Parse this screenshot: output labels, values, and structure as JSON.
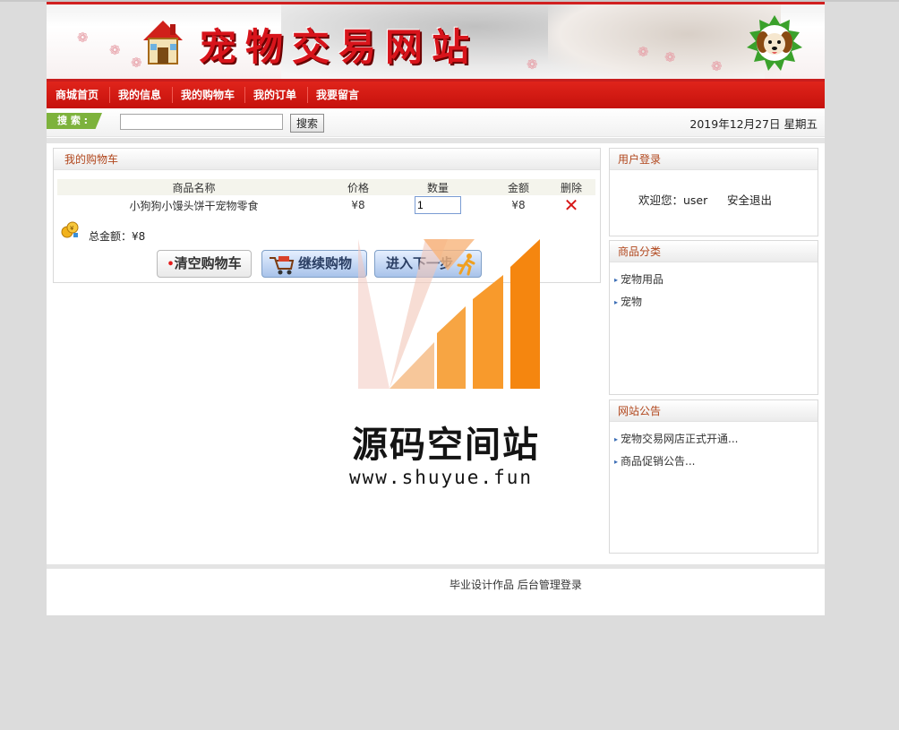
{
  "header": {
    "site_title": "宠物交易网站"
  },
  "nav": {
    "items": [
      {
        "label": "商城首页"
      },
      {
        "label": "我的信息"
      },
      {
        "label": "我的购物车"
      },
      {
        "label": "我的订单"
      },
      {
        "label": "我要留言"
      }
    ]
  },
  "search": {
    "tag_label": "搜 索 :",
    "input_value": "",
    "button_label": "搜索",
    "date_text": "2019年12月27日 星期五"
  },
  "cart": {
    "title": "我的购物车",
    "columns": [
      "商品名称",
      "价格",
      "数量",
      "金额",
      "删除"
    ],
    "rows": [
      {
        "name": "小狗狗小馒头饼干宠物零食",
        "price": "¥8",
        "quantity": "1",
        "amount": "¥8"
      }
    ],
    "total_label": "总金额：¥8",
    "buttons": {
      "clear": "清空购物车",
      "continue": "继续购物",
      "next": "进入下一步"
    }
  },
  "login_panel": {
    "title": "用户登录",
    "welcome": "欢迎您：user",
    "logout": "安全退出"
  },
  "category_panel": {
    "title": "商品分类",
    "items": [
      "宠物用品",
      "宠物"
    ]
  },
  "notice_panel": {
    "title": "网站公告",
    "items": [
      "宠物交易网店正式开通...",
      "商品促销公告..."
    ]
  },
  "footer": {
    "text": "毕业设计作品",
    "admin_link": "后台管理登录"
  },
  "watermark": {
    "title": "源码空间站",
    "url": "www.shuyue.fun"
  },
  "colors": {
    "nav_red": "#d8180f",
    "panel_title": "#b1461c",
    "search_tag_green": "#7db23c",
    "delete_red": "#d71717"
  }
}
